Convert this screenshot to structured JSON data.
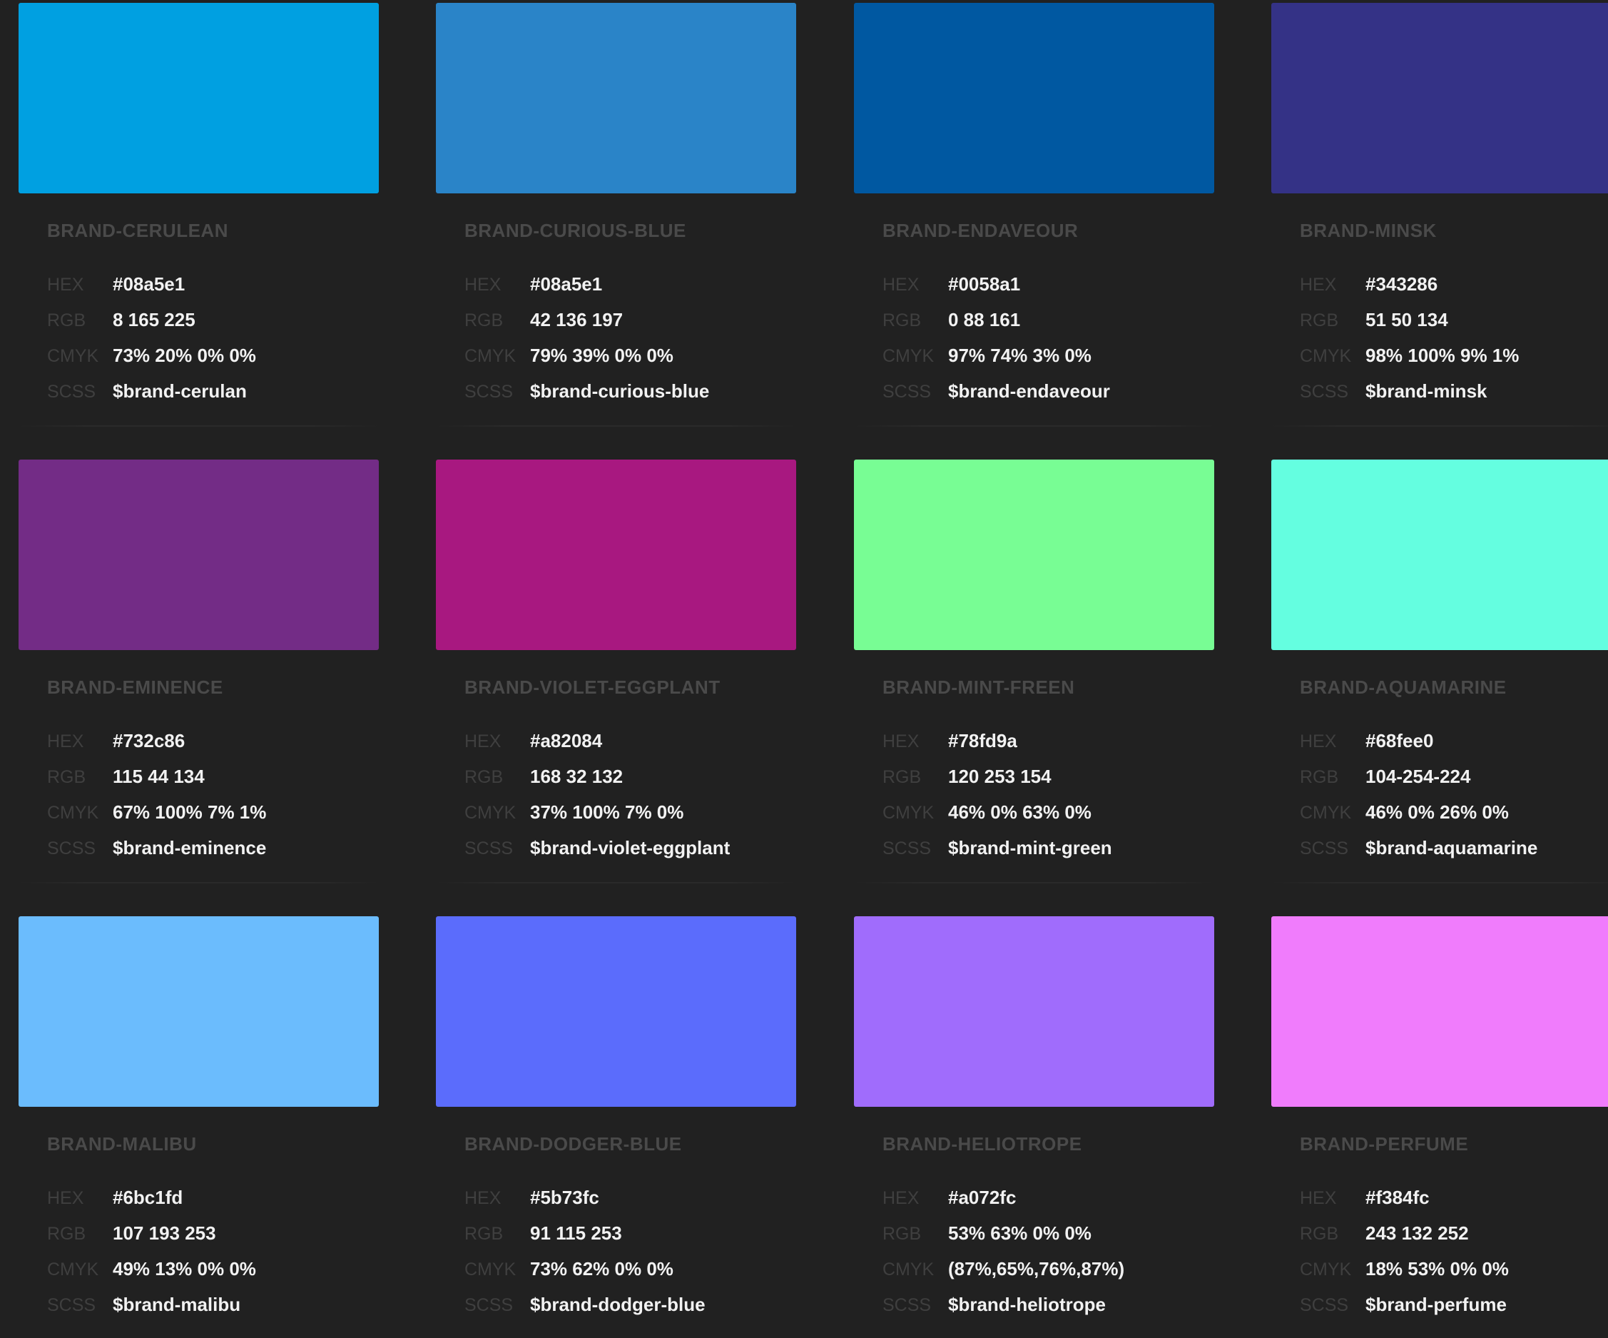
{
  "labels": {
    "hex": "HEX",
    "rgb": "RGB",
    "cmyk": "CMYK",
    "scss": "SCSS"
  },
  "cards": [
    {
      "name": "BRAND-CERULEAN",
      "hex": "#08a5e1",
      "rgb": "8 165 225",
      "cmyk": "73% 20% 0% 0%",
      "scss": "$brand-cerulan",
      "swatch_color": "#00a0e1"
    },
    {
      "name": "BRAND-CURIOUS-BLUE",
      "hex": "#08a5e1",
      "rgb": "42 136 197",
      "cmyk": "79% 39% 0% 0%",
      "scss": "$brand-curious-blue",
      "swatch_color": "#2a84c8"
    },
    {
      "name": "BRAND-ENDAVEOUR",
      "hex": "#0058a1",
      "rgb": "0 88 161",
      "cmyk": "97% 74% 3% 0%",
      "scss": "$brand-endaveour",
      "swatch_color": "#0058a1"
    },
    {
      "name": "BRAND-MINSK",
      "hex": "#343286",
      "rgb": "51 50 134",
      "cmyk": "98% 100% 9% 1%",
      "scss": "$brand-minsk",
      "swatch_color": "#343286"
    },
    {
      "name": "BRAND-EMINENCE",
      "hex": "#732c86",
      "rgb": "115 44 134",
      "cmyk": "67% 100% 7% 1%",
      "scss": "$brand-eminence",
      "swatch_color": "#732c86"
    },
    {
      "name": "BRAND-VIOLET-EGGPLANT",
      "hex": "#a82084",
      "rgb": "168 32 132",
      "cmyk": "37% 100% 7% 0%",
      "scss": "$brand-violet-eggplant",
      "swatch_color": "#a81880"
    },
    {
      "name": "BRAND-MINT-FREEN",
      "hex": "#78fd9a",
      "rgb": "120 253 154",
      "cmyk": "46% 0% 63% 0%",
      "scss": "$brand-mint-green",
      "swatch_color": "#78fd94"
    },
    {
      "name": "BRAND-AQUAMARINE",
      "hex": "#68fee0",
      "rgb": "104-254-224",
      "cmyk": "46% 0% 26% 0%",
      "scss": "$brand-aquamarine",
      "swatch_color": "#64fee0"
    },
    {
      "name": "BRAND-MALIBU",
      "hex": "#6bc1fd",
      "rgb": "107 193 253",
      "cmyk": "49% 13% 0% 0%",
      "scss": "$brand-malibu",
      "swatch_color": "#6bbcfd"
    },
    {
      "name": "BRAND-DODGER-BLUE",
      "hex": "#5b73fc",
      "rgb": "91 115 253",
      "cmyk": "73% 62% 0% 0%",
      "scss": "$brand-dodger-blue",
      "swatch_color": "#5b6cfc"
    },
    {
      "name": "BRAND-HELIOTROPE",
      "hex": "#a072fc",
      "rgb": "53% 63% 0% 0%",
      "cmyk": "(87%,65%,76%,87%)",
      "scss": "$brand-heliotrope",
      "swatch_color": "#a06cfc"
    },
    {
      "name": "BRAND-PERFUME",
      "hex": "#f384fc",
      "rgb": "243 132 252",
      "cmyk": "18% 53% 0% 0%",
      "scss": "$brand-perfume",
      "swatch_color": "#f07cfc"
    }
  ]
}
